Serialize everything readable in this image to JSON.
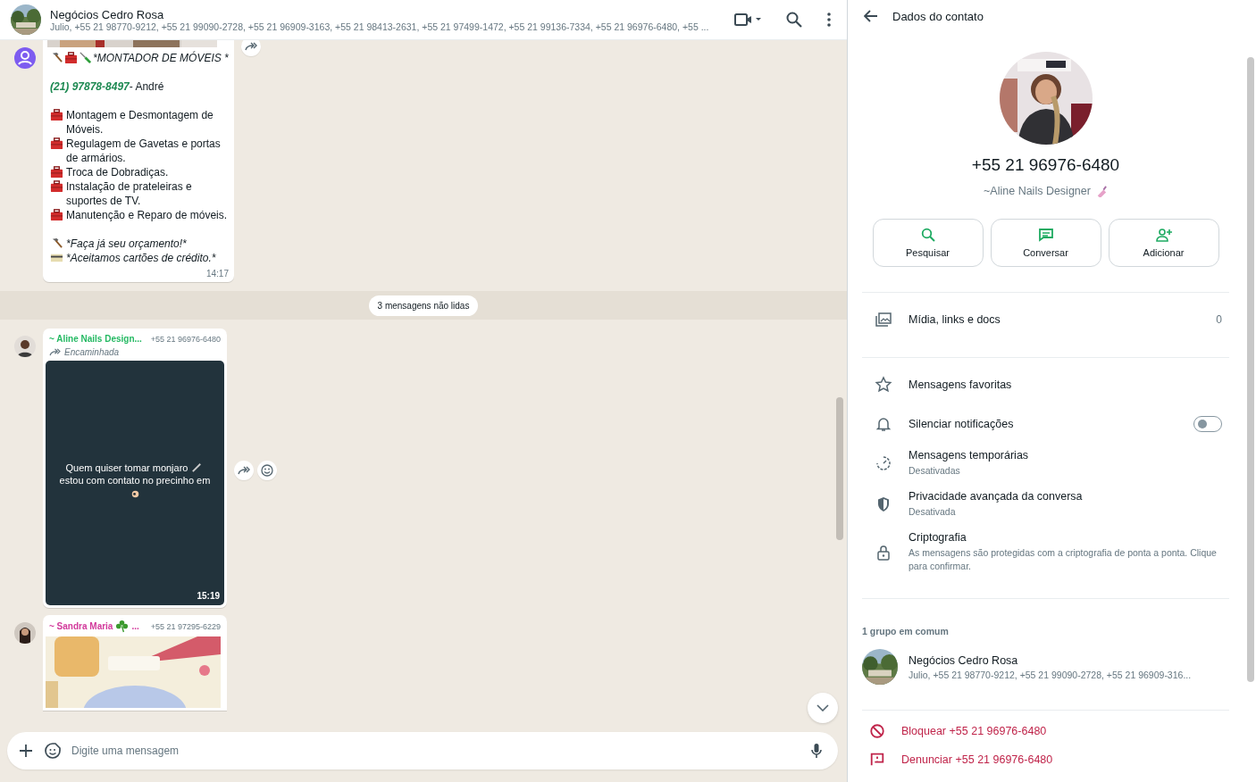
{
  "chat_header": {
    "title": "Negócios Cedro Rosa",
    "members": "Julio, +55 21 98770-9212, +55 21 99090-2728, +55 21 96909-3163, +55 21 98413-2631, +55 21 97499-1472, +55 21 99136-7334, +55 21 96976-6480, +55 ..."
  },
  "message_1": {
    "title": "*MONTADOR DE MÓVEIS *",
    "phone": "(21) 97878-8497",
    "phone_suffix": "- André",
    "services": [
      "Montagem e Desmontagem de Móveis.",
      "Regulagem de Gavetas e portas de armários.",
      "Troca de Dobradiças.",
      "Instalação de prateleiras e suportes de TV.",
      "Manutenção e Reparo de móveis."
    ],
    "closing": [
      "*Faça já seu orçamento!*",
      "*Aceitamos cartões de crédito.*"
    ],
    "time": "14:17"
  },
  "unread_divider": "3 mensagens não lidas",
  "message_2": {
    "sender": "~ Aline Nails Design...",
    "phone": "+55 21 96976-6480",
    "forwarded": "Encaminhada",
    "caption": "Quem quiser tomar monjaro",
    "caption_2": "estou com contato no precinho em",
    "time": "15:19"
  },
  "message_3": {
    "sender": "~ Sandra Maria",
    "sender_suffix": "...",
    "phone": "+55 21 97295-6229"
  },
  "composer": {
    "placeholder": "Digite uma mensagem"
  },
  "contact_panel": {
    "title": "Dados do contato",
    "phone": "+55 21 96976-6480",
    "name": "~Aline Nails Designer",
    "actions": [
      {
        "label": "Pesquisar",
        "kind": "search"
      },
      {
        "label": "Conversar",
        "kind": "chat"
      },
      {
        "label": "Adicionar",
        "kind": "add"
      }
    ],
    "media": {
      "label": "Mídia, links e docs",
      "count": "0"
    },
    "rows": [
      {
        "kind": "plain",
        "label": "Mensagens favoritas"
      },
      {
        "kind": "toggle",
        "label": "Silenciar notificações",
        "on": false
      },
      {
        "kind": "sub",
        "label": "Mensagens temporárias",
        "sub": "Desativadas"
      },
      {
        "kind": "sub",
        "label": "Privacidade avançada da conversa",
        "sub": "Desativada"
      },
      {
        "kind": "sub",
        "label": "Criptografia",
        "sub": "As mensagens são protegidas com a criptografia de ponta a ponta. Clique para confirmar."
      }
    ],
    "groups_heading": "1 grupo em comum",
    "group": {
      "name": "Negócios Cedro Rosa",
      "members": "Julio, +55 21 98770-9212, +55 21 99090-2728, +55 21 96909-316..."
    },
    "danger": [
      {
        "kind": "block",
        "label": "Bloquear +55 21 96976-6480"
      },
      {
        "kind": "report",
        "label": "Denunciar +55 21 96976-6480"
      }
    ]
  }
}
